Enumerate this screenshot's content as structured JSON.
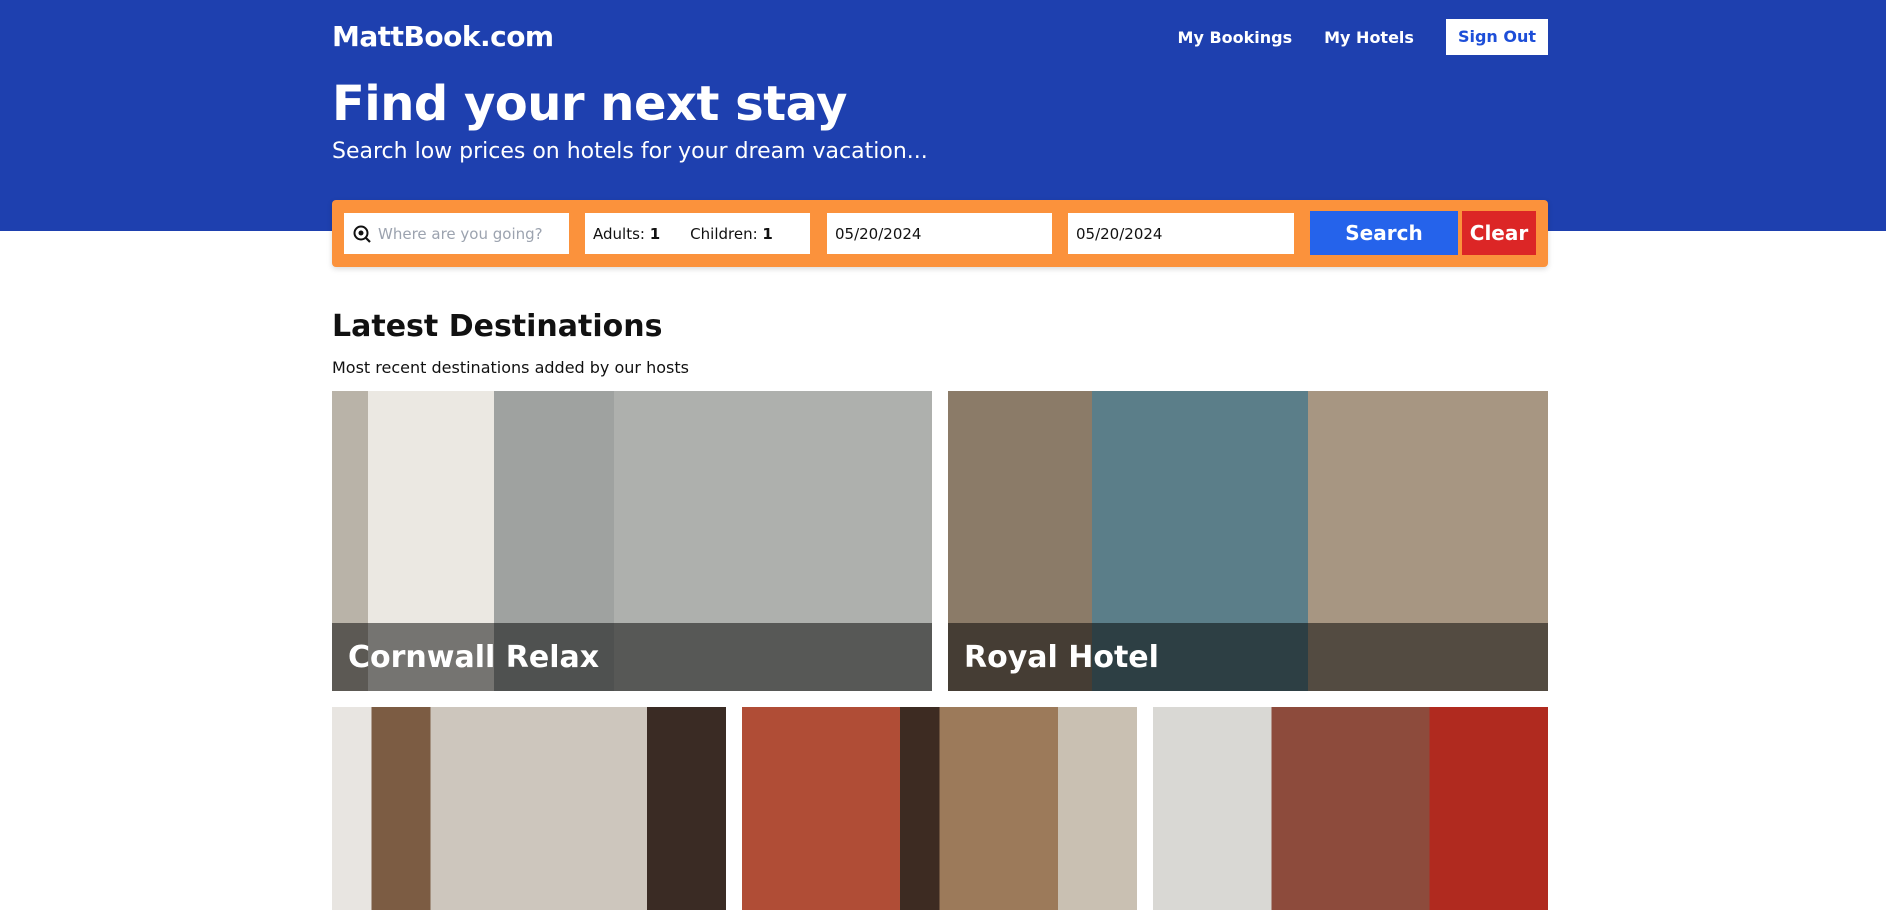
{
  "header": {
    "logo": "MattBook.com",
    "nav": {
      "my_bookings": "My Bookings",
      "my_hotels": "My Hotels",
      "sign_out": "Sign Out"
    },
    "title": "Find your next stay",
    "subtitle": "Search low prices on hotels for your dream vacation..."
  },
  "search": {
    "destination_placeholder": "Where are you going?",
    "adults_label": "Adults:",
    "adults_value": "1",
    "children_label": "Children:",
    "children_value": "1",
    "check_in": "05/20/2024",
    "check_out": "05/20/2024",
    "search_label": "Search",
    "clear_label": "Clear"
  },
  "latest": {
    "title": "Latest Destinations",
    "subtitle": "Most recent destinations added by our hosts",
    "cards": [
      {
        "name": "Cornwall Relax"
      },
      {
        "name": "Royal Hotel"
      },
      {
        "name": ""
      },
      {
        "name": ""
      },
      {
        "name": ""
      }
    ]
  },
  "colors": {
    "hero": "#1e40af",
    "search_bar": "#fb923c",
    "search_button": "#2563eb",
    "clear_button": "#dc2626"
  }
}
